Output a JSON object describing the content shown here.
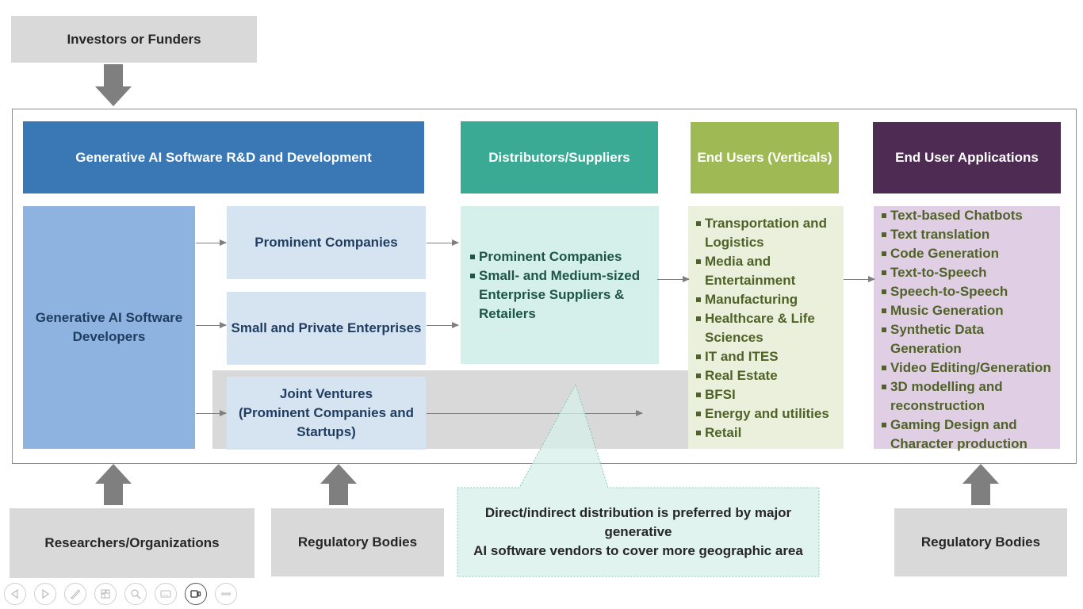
{
  "top": {
    "investors_label": "Investors or Funders"
  },
  "headers": {
    "rnd": "Generative AI Software R&D and Development",
    "distributors": "Distributors/Suppliers",
    "end_users": "End Users (Verticals)",
    "applications": "End User Applications"
  },
  "developers": {
    "label_line1": "Generative AI Software",
    "label_line2": "Developers"
  },
  "company_types": {
    "prominent": "Prominent Companies",
    "small_private": "Small and Private Enterprises",
    "joint_line1": "Joint Ventures",
    "joint_line2": "(Prominent Companies and",
    "joint_line3": "Startups)"
  },
  "distributors_list": [
    "Prominent Companies",
    "Small- and Medium-sized Enterprise Suppliers & Retailers"
  ],
  "verticals_list": [
    "Transportation and Logistics",
    "Media and Entertainment",
    "Manufacturing",
    "Healthcare & Life Sciences",
    "IT and ITES",
    "Real Estate",
    "BFSI",
    "Energy and utilities",
    "Retail"
  ],
  "applications_list": [
    "Text-based Chatbots",
    "Text translation",
    "Code Generation",
    "Text-to-Speech",
    "Speech-to-Speech",
    "Music Generation",
    "Synthetic Data Generation",
    "Video Editing/Generation",
    "3D modelling and reconstruction",
    "Gaming Design and Character production"
  ],
  "bottom": {
    "researchers": "Researchers/Organizations",
    "regulatory_left": "Regulatory Bodies",
    "regulatory_right": "Regulatory Bodies",
    "callout_line1": "Direct/indirect distribution is preferred by major generative",
    "callout_line2": "AI software vendors to cover more geographic area"
  },
  "colors": {
    "rnd_header": "#3a78b5",
    "distributors_header": "#3aaa94",
    "end_users_header": "#9fba55",
    "applications_header": "#4e2b52",
    "developers_box": "#8eb3e1",
    "distributors_box": "#d5efea",
    "verticals_box": "#ebf0dc",
    "applications_box": "#e0cfe4"
  },
  "toolbar": {
    "buttons": [
      "previous-slide",
      "next-slide",
      "pen",
      "see-all-slides",
      "zoom",
      "subtitles",
      "camera",
      "more-options"
    ]
  }
}
